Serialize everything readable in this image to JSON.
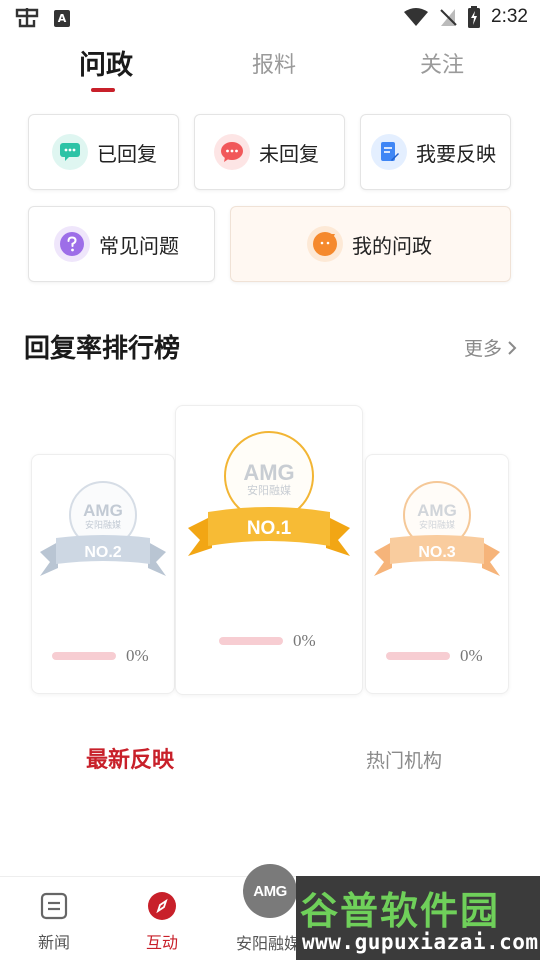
{
  "status_bar": {
    "time": "2:32"
  },
  "top_tabs": [
    {
      "label": "问政",
      "active": true
    },
    {
      "label": "报料",
      "active": false
    },
    {
      "label": "关注",
      "active": false
    }
  ],
  "actions": [
    {
      "label": "已回复",
      "icon": "chat-bubble-icon",
      "color": "#2cc3a6"
    },
    {
      "label": "未回复",
      "icon": "chat-bubble-icon",
      "color": "#f1585a"
    },
    {
      "label": "我要反映",
      "icon": "edit-document-icon",
      "color": "#3f86f5"
    },
    {
      "label": "常见问题",
      "icon": "question-icon",
      "color": "#9d6ee8"
    },
    {
      "label": "我的问政",
      "icon": "face-icon",
      "color": "#f5892d"
    }
  ],
  "ranking": {
    "title": "回复率排行榜",
    "more_label": "更多",
    "podium": [
      {
        "rank_label": "NO.2",
        "percent_label": "0%",
        "percent": 0,
        "ribbon_color": "#c3cfdd"
      },
      {
        "rank_label": "NO.1",
        "percent_label": "0%",
        "percent": 0,
        "ribbon_color": "#f6b62c"
      },
      {
        "rank_label": "NO.3",
        "percent_label": "0%",
        "percent": 0,
        "ribbon_color": "#f8c694"
      }
    ]
  },
  "section_tabs": [
    {
      "label": "最新反映",
      "active": true
    },
    {
      "label": "热门机构",
      "active": false
    }
  ],
  "bottom_nav": [
    {
      "label": "新闻",
      "icon": "news-icon",
      "active": false
    },
    {
      "label": "互动",
      "icon": "compass-icon",
      "active": true
    },
    {
      "label": "安阳融媒",
      "icon": "amg-logo-icon",
      "active": false
    }
  ],
  "logo_text": "AMG",
  "medal_logo_sub": "安阳融媒",
  "watermark": {
    "title": "谷普软件园",
    "url": "www.gupuxiazai.com"
  },
  "colors": {
    "accent": "#c8202a"
  }
}
